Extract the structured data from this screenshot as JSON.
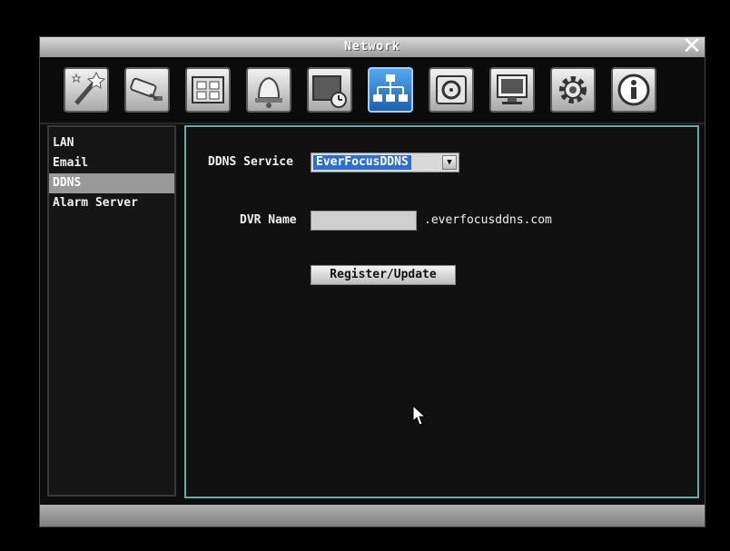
{
  "window": {
    "title": "Network",
    "close_label": "✕"
  },
  "toolbar": {
    "buttons": [
      {
        "icon": "quick-setup-wand-icon"
      },
      {
        "icon": "camera-icon"
      },
      {
        "icon": "film-record-icon"
      },
      {
        "icon": "alarm-bell-icon"
      },
      {
        "icon": "hdd-schedule-icon"
      },
      {
        "icon": "network-icon",
        "active": true
      },
      {
        "icon": "disk-icon"
      },
      {
        "icon": "monitor-icon"
      },
      {
        "icon": "gear-icon"
      },
      {
        "icon": "info-icon"
      }
    ]
  },
  "sidebar": {
    "items": [
      {
        "label": "LAN"
      },
      {
        "label": "Email"
      },
      {
        "label": "DDNS",
        "selected": true
      },
      {
        "label": "Alarm Server"
      }
    ]
  },
  "ddns": {
    "service_label": "DDNS Service",
    "service_value": "EverFocusDDNS",
    "dropdown_arrow": "▼",
    "dvr_name_label": "DVR Name",
    "dvr_name_value": "",
    "domain_suffix": ".everfocusddns.com",
    "register_button": "Register/Update"
  },
  "colors": {
    "active_tab": "#2a6fd1",
    "content_border": "#6fa7a7",
    "selected_item": "#999999"
  }
}
